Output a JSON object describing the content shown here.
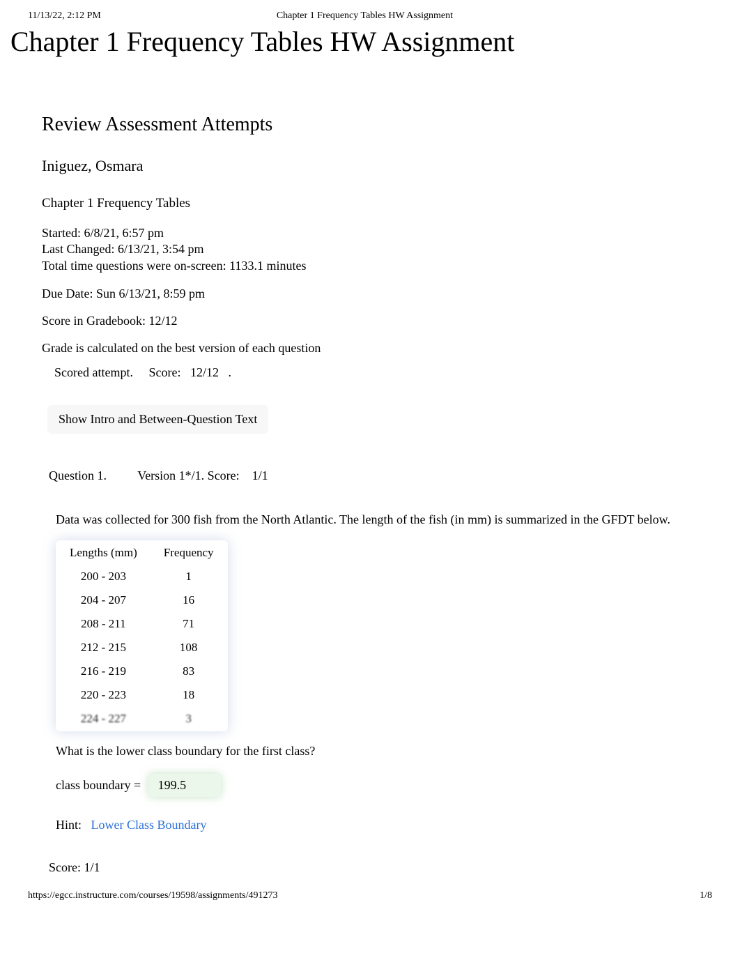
{
  "print_header": {
    "left": "11/13/22, 2:12 PM",
    "center": "Chapter 1 Frequency Tables HW Assignment"
  },
  "page_title": "Chapter 1 Frequency Tables HW Assignment",
  "section_heading": "Review Assessment Attempts",
  "student_name": "Iniguez, Osmara",
  "assignment_name": "Chapter 1 Frequency Tables",
  "meta": {
    "started": "Started: 6/8/21, 6:57 pm",
    "last_changed": "Last Changed: 6/13/21, 3:54 pm",
    "total_time": "Total time questions were on-screen: 1133.1 minutes"
  },
  "due_date": "Due Date: Sun 6/13/21, 8:59 pm",
  "score_gradebook": "Score in Gradebook: 12/12",
  "grade_note": "Grade is calculated on the best version of each question",
  "scored_attempt": {
    "label": "Scored attempt.",
    "score_label": "Score:",
    "score_value": "12/12",
    "trail": "."
  },
  "show_intro_button": "Show Intro and Between-Question Text",
  "question": {
    "number_label": "Question 1.",
    "version_label": "Version 1*/1. Score:",
    "version_score": "1/1",
    "text": "Data was collected for 300 fish from the North Atlantic. The length of the fish (in mm) is summarized in the GFDT below.",
    "table": {
      "headers": [
        "Lengths (mm)",
        "Frequency"
      ],
      "rows": [
        [
          "200 - 203",
          "1"
        ],
        [
          "204 - 207",
          "16"
        ],
        [
          "208 - 211",
          "71"
        ],
        [
          "212 - 215",
          "108"
        ],
        [
          "216 - 219",
          "83"
        ],
        [
          "220 - 223",
          "18"
        ],
        [
          "224 - 227",
          "3"
        ]
      ]
    },
    "prompt": "What is the lower class boundary for the first class?",
    "answer_label": "class boundary =",
    "answer_value": "199.5",
    "hint_label": "Hint:",
    "hint_link": "Lower Class Boundary",
    "score_footer": "Score: 1/1"
  },
  "print_footer": {
    "url": "https://egcc.instructure.com/courses/19598/assignments/491273",
    "page": "1/8"
  }
}
